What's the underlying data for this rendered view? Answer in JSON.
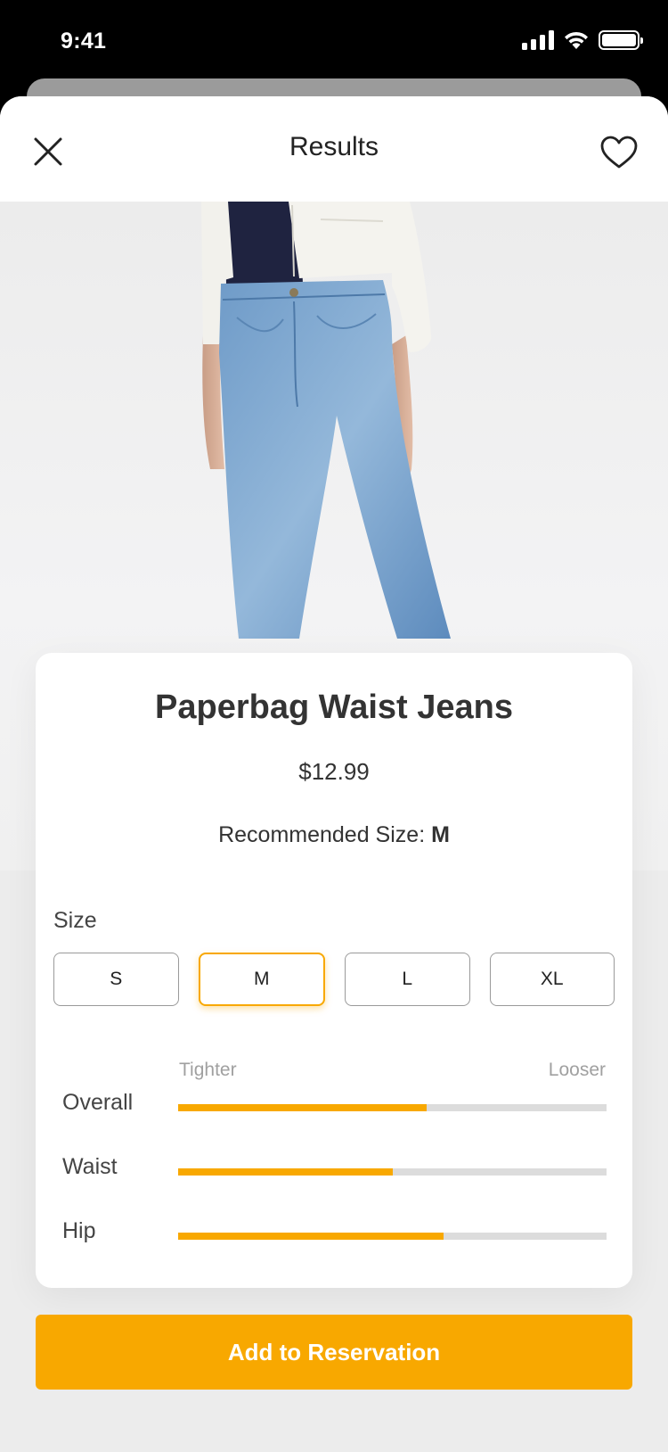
{
  "status_bar": {
    "time": "9:41"
  },
  "header": {
    "title": "Results"
  },
  "product": {
    "name": "Paperbag Waist Jeans",
    "price": "$12.99",
    "recommended_label": "Recommended Size:",
    "recommended_value": "M"
  },
  "size": {
    "label": "Size",
    "options": [
      "S",
      "M",
      "L",
      "XL"
    ],
    "selected": "M"
  },
  "fit": {
    "min_label": "Tighter",
    "max_label": "Looser",
    "rows": [
      {
        "label": "Overall",
        "value": 0.58
      },
      {
        "label": "Waist",
        "value": 0.5
      },
      {
        "label": "Hip",
        "value": 0.62
      }
    ]
  },
  "cta": {
    "label": "Add to Reservation"
  },
  "colors": {
    "accent": "#F8A800",
    "track": "#DCDCDC",
    "background": "#ECECEC"
  },
  "icons": [
    "close-icon",
    "heart-icon",
    "signal-icon",
    "wifi-icon",
    "battery-icon"
  ]
}
